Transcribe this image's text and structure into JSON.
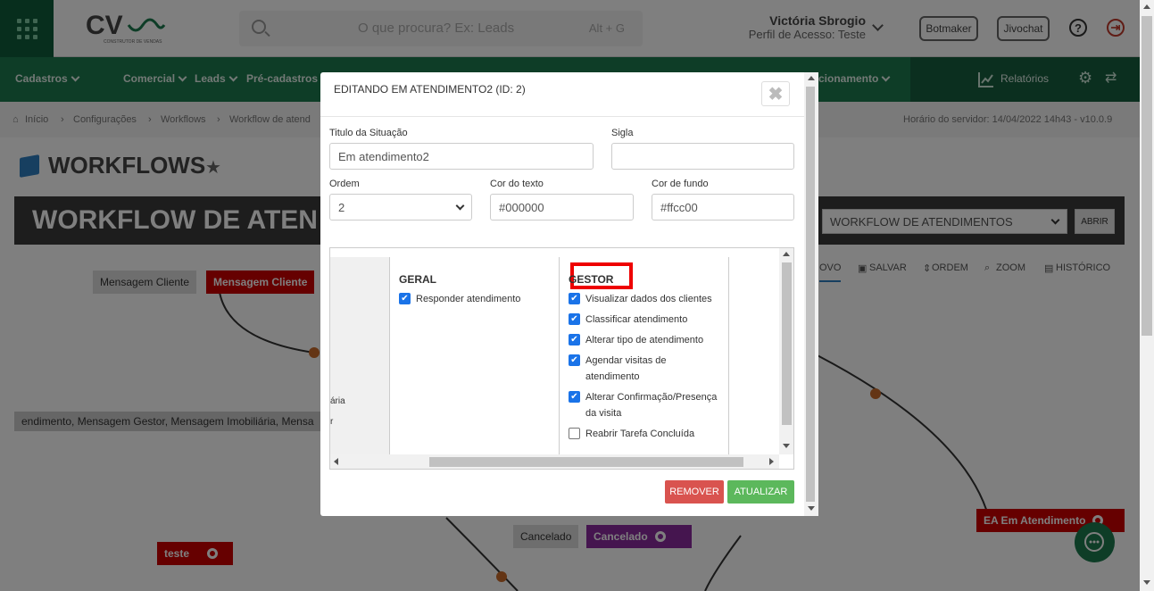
{
  "header": {
    "logo_text": "CV",
    "logo_sub": "CONSTRUTOR DE VENDAS",
    "search_placeholder": "O que procura? Ex: Leads",
    "search_shortcut": "Alt + G",
    "user_name": "Victória Sbrogio",
    "user_role": "Perfil de Acesso: Teste",
    "botmaker_label": "Botmaker",
    "jivochat_label": "Jivochat",
    "help_icon": "?",
    "exit_icon": "⇥"
  },
  "nav": {
    "items": [
      "Cadastros",
      "Comercial",
      "Leads",
      "Pré-cadastros",
      "cionamento",
      "Relatórios"
    ]
  },
  "breadcrumb": {
    "items": [
      "Início",
      "Configurações",
      "Workflows",
      "Workflow de atend"
    ],
    "server_time": "Horário do servidor: 14/04/2022 14h43 - v10.0.9"
  },
  "page": {
    "title": "WORKFLOWS",
    "banner_title": "WORKFLOW DE ATEN",
    "workflow_select": "WORKFLOW DE ATENDIMENTOS",
    "abrir_label": "ABRIR",
    "toolbar": {
      "novo": "OVO",
      "salvar": "SALVAR",
      "ordem": "ORDEM",
      "zoom": "ZOOM",
      "historico": "HISTÓRICO"
    }
  },
  "canvas": {
    "label_msg_cliente_gray": "Mensagem Cliente",
    "label_msg_cliente_red": "Mensagem Cliente",
    "long_label": "endimento, Mensagem Gestor, Mensagem Imobiliária, Mensa",
    "cancelado_gray": "Cancelado",
    "cancelado_purple": "Cancelado",
    "teste": "teste",
    "ea_node": "EA   Em Atendimento"
  },
  "modal": {
    "title": "EDITANDO EM ATENDIMENTO2 (ID: 2)",
    "close_icon": "✖",
    "titulo_label": "Titulo da Situação",
    "titulo_value": "Em atendimento2",
    "sigla_label": "Sigla",
    "sigla_value": "",
    "ordem_label": "Ordem",
    "ordem_value": "2",
    "cor_texto_label": "Cor do texto",
    "cor_texto_value": "#000000",
    "cor_fundo_label": "Cor de fundo",
    "cor_fundo_value": "#ffcc00",
    "partial_left": [
      "ária",
      "r"
    ],
    "geral_header": "GERAL",
    "geral_items": [
      {
        "label": "Responder atendimento",
        "checked": true
      }
    ],
    "gestor_header": "GESTOR",
    "gestor_items": [
      {
        "label": "Visualizar dados dos clientes",
        "checked": true
      },
      {
        "label": "Classificar atendimento",
        "checked": true
      },
      {
        "label": "Alterar tipo de atendimento",
        "checked": true
      },
      {
        "label": "Agendar visitas de atendimento",
        "checked": true
      },
      {
        "label": "Alterar Confirmação/Presença da visita",
        "checked": true
      },
      {
        "label": "Reabrir Tarefa Concluída",
        "checked": false
      }
    ],
    "remover_label": "REMOVER",
    "atualizar_label": "ATUALIZAR"
  },
  "colors": {
    "brand_green": "#1c7a4f",
    "remove_red": "#d9534f",
    "update_green": "#5cb85c",
    "checkbox_blue": "#1a73e8",
    "highlight_red": "#ee0000"
  }
}
